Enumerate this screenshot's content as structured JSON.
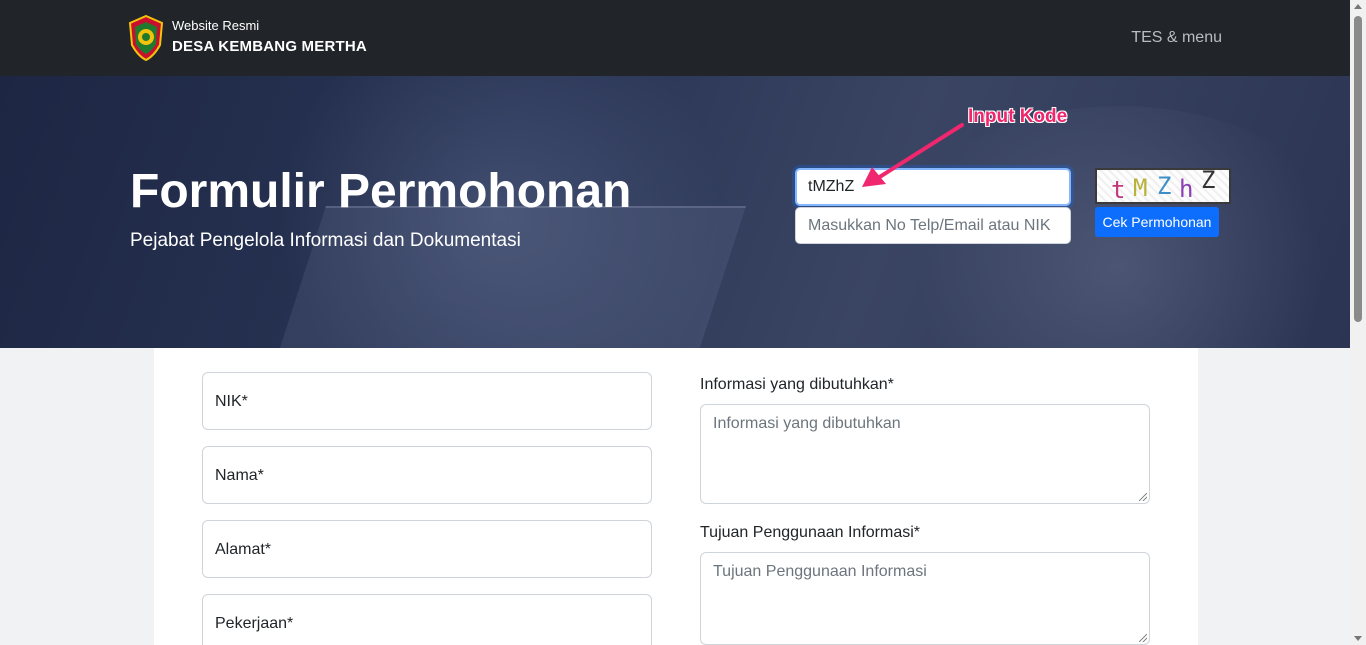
{
  "header": {
    "brand_small": "Website Resmi",
    "brand_name": "DESA KEMBANG MERTHA",
    "menu_label": "TES & menu"
  },
  "hero": {
    "title": "Formulir Permohonan",
    "subtitle": "Pejabat Pengelola Informasi dan Dokumentasi"
  },
  "check_form": {
    "captcha_code_value": "tMZhZ",
    "identity_placeholder": "Masukkan No Telp/Email atau NIK",
    "captcha_text": "tMZhZ",
    "check_button_label": "Cek Permohonan"
  },
  "annotation": {
    "text": "Input Kode",
    "color": "#f0276e"
  },
  "form": {
    "left_fields": [
      "NIK*",
      "Nama*",
      "Alamat*",
      "Pekerjaan*"
    ],
    "info_label": "Informasi yang dibutuhkan*",
    "info_placeholder": "Informasi yang dibutuhkan",
    "purpose_label": "Tujuan Penggunaan Informasi*",
    "purpose_placeholder": "Tujuan Penggunaan Informasi"
  },
  "colors": {
    "navbar": "#212529",
    "primary": "#0d6efd"
  }
}
